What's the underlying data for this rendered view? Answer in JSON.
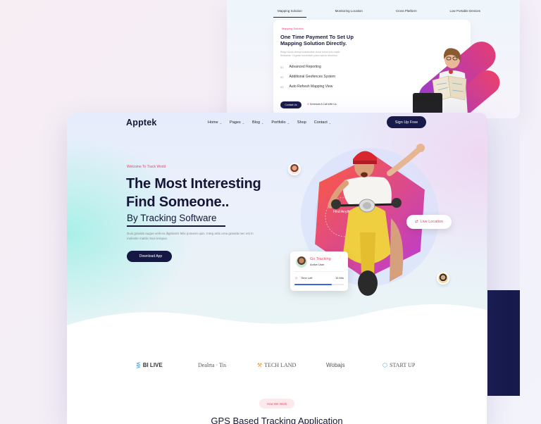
{
  "back_card": {
    "tabs": [
      "Mapping Solution",
      "Monitoring Location",
      "Cross Platform",
      "Low Portable Devices"
    ],
    "kicker": "Mapping Solution",
    "title": "One Time Payment To Set Up Mapping Solution Directly.",
    "description": "Ridge tacos disrupt sustainable cloud bread tofu made flexitarian. Organic shoreditch paleo salvia helvetica.",
    "features": [
      {
        "num": "01",
        "label": "Advanced Reporting"
      },
      {
        "num": "02",
        "label": "Additional Geofences System"
      },
      {
        "num": "03",
        "label": "Auto Refresh Mapping View"
      }
    ],
    "button": "Contact Us",
    "phone": "Schedule A Call With Us"
  },
  "nav": {
    "logo": "Apptek",
    "menu": [
      {
        "label": "Home",
        "chevron": true
      },
      {
        "label": "Pages",
        "chevron": true
      },
      {
        "label": "Blog",
        "chevron": true
      },
      {
        "label": "Portfolio",
        "chevron": true
      },
      {
        "label": "Shop",
        "chevron": false
      },
      {
        "label": "Contact",
        "chevron": true
      }
    ],
    "signup": "Sign Up Free"
  },
  "hero": {
    "welcome": "Welcome To Track World",
    "title": "The Most Interesting Find Someone..",
    "subtitle": "By Tracking Software",
    "description": "Duis gravida augue velit eu dignissim felis posuere quis. Integ artis urna gravida nec est in molestie mattis risus tempus.",
    "download_btn": "Download App",
    "live_location": "Live Location",
    "track_card": {
      "title": "Go Tracking",
      "subtitle": "Active User",
      "time_label": "Time Left",
      "time_value": "15 Min",
      "progress": 0.75
    },
    "circle_text": "Find Anything Anyone"
  },
  "partners": [
    "BI LIVE",
    "Dealrta · Tis",
    "TECH LAND",
    "Wobajs",
    "START UP"
  ],
  "how_we_work": "How We Work",
  "section_title": "GPS Based Tracking Application",
  "colors": {
    "accent": "#e24a66",
    "navy": "#171a4a"
  }
}
